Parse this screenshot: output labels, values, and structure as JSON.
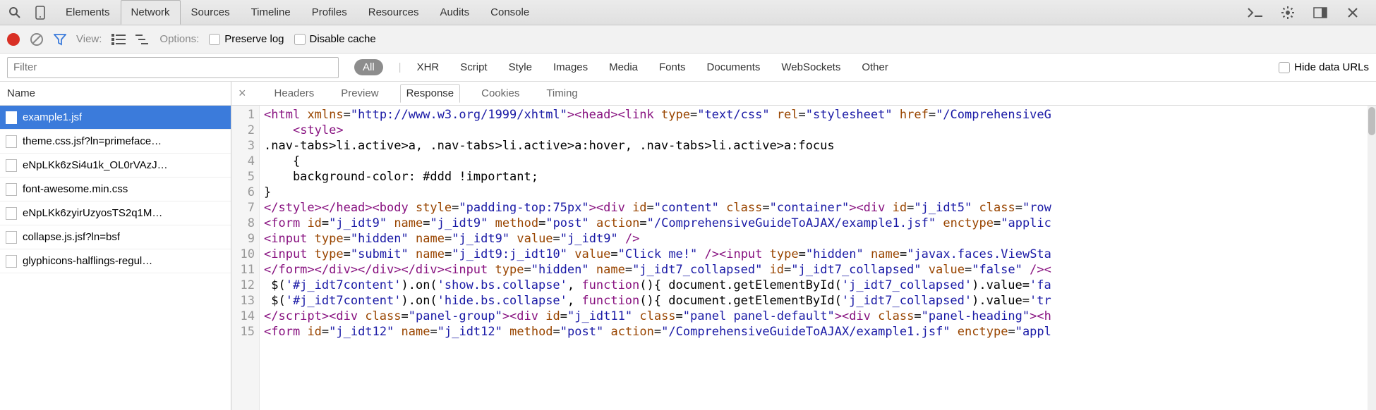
{
  "tabs": [
    "Elements",
    "Network",
    "Sources",
    "Timeline",
    "Profiles",
    "Resources",
    "Audits",
    "Console"
  ],
  "active_tab": "Network",
  "toolbar": {
    "view_label": "View:",
    "options_label": "Options:",
    "preserve_log": "Preserve log",
    "disable_cache": "Disable cache"
  },
  "filter": {
    "placeholder": "Filter",
    "all": "All",
    "items": [
      "XHR",
      "Script",
      "Style",
      "Images",
      "Media",
      "Fonts",
      "Documents",
      "WebSockets",
      "Other"
    ],
    "hide_data_urls": "Hide data URLs"
  },
  "sidebar": {
    "header": "Name",
    "requests": [
      "example1.jsf",
      "theme.css.jsf?ln=primeface…",
      "eNpLKk6zSi4u1k_OL0rVAzJ…",
      "font-awesome.min.css",
      "eNpLKk6zyirUzyosTS2q1M…",
      "collapse.js.jsf?ln=bsf",
      "glyphicons-halflings-regul…"
    ],
    "selected_index": 0
  },
  "subtabs": [
    "Headers",
    "Preview",
    "Response",
    "Cookies",
    "Timing"
  ],
  "active_subtab": "Response",
  "code": {
    "lines": [
      {
        "n": 1,
        "html": "<span class='tag'>&lt;html</span> <span class='attr'>xmlns</span>=<span class='val'>\"http://www.w3.org/1999/xhtml\"</span><span class='tag'>&gt;&lt;head&gt;&lt;link</span> <span class='attr'>type</span>=<span class='val'>\"text/css\"</span> <span class='attr'>rel</span>=<span class='val'>\"stylesheet\"</span> <span class='attr'>href</span>=<span class='val'>\"/ComprehensiveG</span>"
      },
      {
        "n": 2,
        "html": "    <span class='tag'>&lt;style&gt;</span>"
      },
      {
        "n": 3,
        "html": "<span class='txt'>.nav-tabs&gt;li.active&gt;a, .nav-tabs&gt;li.active&gt;a:hover, .nav-tabs&gt;li.active&gt;a:focus</span>"
      },
      {
        "n": 4,
        "html": "<span class='txt'>    {</span>"
      },
      {
        "n": 5,
        "html": "<span class='txt'>    background-color: #ddd !important;</span>"
      },
      {
        "n": 6,
        "html": "<span class='txt'>}</span>"
      },
      {
        "n": 7,
        "html": "<span class='tag'>&lt;/style&gt;&lt;/head&gt;&lt;body</span> <span class='attr'>style</span>=<span class='val'>\"padding-top:75px\"</span><span class='tag'>&gt;&lt;div</span> <span class='attr'>id</span>=<span class='val'>\"content\"</span> <span class='attr'>class</span>=<span class='val'>\"container\"</span><span class='tag'>&gt;&lt;div</span> <span class='attr'>id</span>=<span class='val'>\"j_idt5\"</span> <span class='attr'>class</span>=<span class='val'>\"row</span>"
      },
      {
        "n": 8,
        "html": "<span class='tag'>&lt;form</span> <span class='attr'>id</span>=<span class='val'>\"j_idt9\"</span> <span class='attr'>name</span>=<span class='val'>\"j_idt9\"</span> <span class='attr'>method</span>=<span class='val'>\"post\"</span> <span class='attr'>action</span>=<span class='val'>\"/ComprehensiveGuideToAJAX/example1.jsf\"</span> <span class='attr'>enctype</span>=<span class='val'>\"applic</span>"
      },
      {
        "n": 9,
        "html": "<span class='tag'>&lt;input</span> <span class='attr'>type</span>=<span class='val'>\"hidden\"</span> <span class='attr'>name</span>=<span class='val'>\"j_idt9\"</span> <span class='attr'>value</span>=<span class='val'>\"j_idt9\"</span> <span class='tag'>/&gt;</span>"
      },
      {
        "n": 10,
        "html": "<span class='tag'>&lt;input</span> <span class='attr'>type</span>=<span class='val'>\"submit\"</span> <span class='attr'>name</span>=<span class='val'>\"j_idt9:j_idt10\"</span> <span class='attr'>value</span>=<span class='val'>\"Click me!\"</span> <span class='tag'>/&gt;&lt;input</span> <span class='attr'>type</span>=<span class='val'>\"hidden\"</span> <span class='attr'>name</span>=<span class='val'>\"javax.faces.ViewSta</span>"
      },
      {
        "n": 11,
        "html": "<span class='tag'>&lt;/form&gt;&lt;/div&gt;&lt;/div&gt;&lt;/div&gt;&lt;input</span> <span class='attr'>type</span>=<span class='val'>\"hidden\"</span> <span class='attr'>name</span>=<span class='val'>\"j_idt7_collapsed\"</span> <span class='attr'>id</span>=<span class='val'>\"j_idt7_collapsed\"</span> <span class='attr'>value</span>=<span class='val'>\"false\"</span> <span class='tag'>/&gt;&lt;</span>"
      },
      {
        "n": 12,
        "html": "<span class='txt'> $(</span><span class='val'>'#j_idt7content'</span><span class='txt'>).on(</span><span class='val'>'show.bs.collapse'</span><span class='txt'>, </span><span class='tag'>function</span><span class='txt'>(){ document.getElementById(</span><span class='val'>'j_idt7_collapsed'</span><span class='txt'>).value=</span><span class='val'>'fa</span>"
      },
      {
        "n": 13,
        "html": "<span class='txt'> $(</span><span class='val'>'#j_idt7content'</span><span class='txt'>).on(</span><span class='val'>'hide.bs.collapse'</span><span class='txt'>, </span><span class='tag'>function</span><span class='txt'>(){ document.getElementById(</span><span class='val'>'j_idt7_collapsed'</span><span class='txt'>).value=</span><span class='val'>'tr</span>"
      },
      {
        "n": 14,
        "html": "<span class='tag'>&lt;/script&gt;&lt;div</span> <span class='attr'>class</span>=<span class='val'>\"panel-group\"</span><span class='tag'>&gt;&lt;div</span> <span class='attr'>id</span>=<span class='val'>\"j_idt11\"</span> <span class='attr'>class</span>=<span class='val'>\"panel panel-default\"</span><span class='tag'>&gt;&lt;div</span> <span class='attr'>class</span>=<span class='val'>\"panel-heading\"</span><span class='tag'>&gt;&lt;h</span>"
      },
      {
        "n": 15,
        "html": "<span class='tag'>&lt;form</span> <span class='attr'>id</span>=<span class='val'>\"j_idt12\"</span> <span class='attr'>name</span>=<span class='val'>\"j_idt12\"</span> <span class='attr'>method</span>=<span class='val'>\"post\"</span> <span class='attr'>action</span>=<span class='val'>\"/ComprehensiveGuideToAJAX/example1.jsf\"</span> <span class='attr'>enctype</span>=<span class='val'>\"appl</span>"
      }
    ]
  }
}
